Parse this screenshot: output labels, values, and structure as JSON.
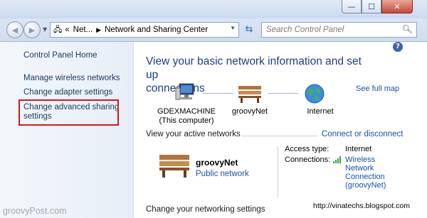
{
  "window": {
    "controls": {
      "minimize": "—",
      "maximize": "☐",
      "close": "✕"
    }
  },
  "navigation": {
    "back_icon": "back-arrow-icon",
    "forward_icon": "forward-arrow-icon",
    "address": {
      "overflow": "«",
      "crumb1": "Net...",
      "crumb2": "Network and Sharing Center"
    },
    "search_placeholder": "Search Control Panel"
  },
  "sidebar": {
    "home": "Control Panel Home",
    "items": [
      "Manage wireless networks",
      "Change adapter settings",
      "Change advanced sharing",
      "settings"
    ]
  },
  "main": {
    "heading_line1": "View your basic network information and set up",
    "heading_line2": "connections",
    "see_full_map": "See full map",
    "map": {
      "computer_line1": "GDEXMACHINE",
      "computer_line2": "(This computer)",
      "network": "groovyNet",
      "internet": "Internet"
    },
    "active_networks_label": "View your active networks",
    "connect_disconnect": "Connect or disconnect",
    "network": {
      "name": "groovyNet",
      "type": "Public network",
      "access_type_label": "Access type:",
      "access_type_value": "Internet",
      "connections_label": "Connections:",
      "connection_line1": "Wireless",
      "connection_line2": "Network",
      "connection_line3": "Connection",
      "connection_line4": "(groovyNet)"
    },
    "partial_heading": "Change your networking settings"
  },
  "watermarks": {
    "left": "groovyPost.com",
    "right": "http://vinatechs.blogspot.com"
  },
  "colors": {
    "link": "#1553a8",
    "heading": "#1a3f86",
    "highlight_box": "#d8161d"
  }
}
